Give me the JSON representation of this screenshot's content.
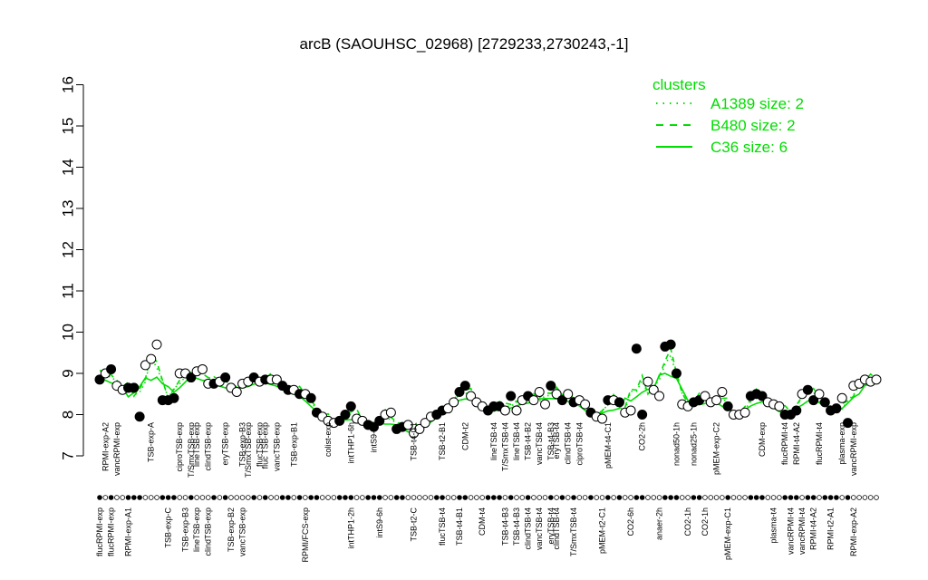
{
  "chart_data": {
    "type": "line",
    "title": "arcB (SAOUHSC_02968) [2729233,2730243,-1]",
    "ylim": [
      7,
      16
    ],
    "yticks": [
      7,
      8,
      9,
      10,
      11,
      12,
      13,
      14,
      15,
      16
    ],
    "legend": {
      "title": "clusters",
      "placement": "top-right",
      "items": [
        {
          "label": "A1389 size: 2",
          "style": "dotted"
        },
        {
          "label": "B480 size: 2",
          "style": "dashed"
        },
        {
          "label": "C36 size: 6",
          "style": "solid"
        }
      ]
    },
    "colors": {
      "lines": "#00dd00",
      "points_stroke": "#000000",
      "filled": "#000000",
      "open": "#ffffff"
    },
    "points": [
      {
        "y": 8.85,
        "f": 1
      },
      {
        "y": 9.0,
        "f": 0
      },
      {
        "y": 9.1,
        "f": 1
      },
      {
        "y": 8.7,
        "f": 0
      },
      {
        "y": 8.6,
        "f": 0
      },
      {
        "y": 8.65,
        "f": 1
      },
      {
        "y": 8.65,
        "f": 1
      },
      {
        "y": 7.95,
        "f": 1
      },
      {
        "y": 9.2,
        "f": 0
      },
      {
        "y": 9.35,
        "f": 0
      },
      {
        "y": 9.7,
        "f": 0
      },
      {
        "y": 8.35,
        "f": 1
      },
      {
        "y": 8.35,
        "f": 1
      },
      {
        "y": 8.4,
        "f": 1
      },
      {
        "y": 9.0,
        "f": 0
      },
      {
        "y": 9.0,
        "f": 0
      },
      {
        "y": 8.9,
        "f": 1
      },
      {
        "y": 9.05,
        "f": 0
      },
      {
        "y": 9.1,
        "f": 0
      },
      {
        "y": 8.75,
        "f": 0
      },
      {
        "y": 8.75,
        "f": 1
      },
      {
        "y": 8.8,
        "f": 0
      },
      {
        "y": 8.9,
        "f": 1
      },
      {
        "y": 8.65,
        "f": 0
      },
      {
        "y": 8.55,
        "f": 0
      },
      {
        "y": 8.75,
        "f": 0
      },
      {
        "y": 8.8,
        "f": 0
      },
      {
        "y": 8.9,
        "f": 1
      },
      {
        "y": 8.8,
        "f": 0
      },
      {
        "y": 8.85,
        "f": 1
      },
      {
        "y": 8.85,
        "f": 0
      },
      {
        "y": 8.85,
        "f": 0
      },
      {
        "y": 8.7,
        "f": 1
      },
      {
        "y": 8.6,
        "f": 1
      },
      {
        "y": 8.6,
        "f": 0
      },
      {
        "y": 8.5,
        "f": 1
      },
      {
        "y": 8.5,
        "f": 0
      },
      {
        "y": 8.4,
        "f": 1
      },
      {
        "y": 8.05,
        "f": 1
      },
      {
        "y": 7.95,
        "f": 0
      },
      {
        "y": 7.85,
        "f": 0
      },
      {
        "y": 7.8,
        "f": 0
      },
      {
        "y": 7.85,
        "f": 1
      },
      {
        "y": 8.0,
        "f": 1
      },
      {
        "y": 8.2,
        "f": 1
      },
      {
        "y": 7.9,
        "f": 0
      },
      {
        "y": 7.85,
        "f": 0
      },
      {
        "y": 7.75,
        "f": 1
      },
      {
        "y": 7.7,
        "f": 1
      },
      {
        "y": 7.85,
        "f": 1
      },
      {
        "y": 8.0,
        "f": 0
      },
      {
        "y": 8.05,
        "f": 0
      },
      {
        "y": 7.65,
        "f": 1
      },
      {
        "y": 7.7,
        "f": 1
      },
      {
        "y": 7.75,
        "f": 0
      },
      {
        "y": 7.55,
        "f": 0
      },
      {
        "y": 7.65,
        "f": 0
      },
      {
        "y": 7.8,
        "f": 0
      },
      {
        "y": 7.95,
        "f": 0
      },
      {
        "y": 8.0,
        "f": 1
      },
      {
        "y": 8.1,
        "f": 1
      },
      {
        "y": 8.15,
        "f": 0
      },
      {
        "y": 8.3,
        "f": 0
      },
      {
        "y": 8.55,
        "f": 1
      },
      {
        "y": 8.7,
        "f": 1
      },
      {
        "y": 8.45,
        "f": 0
      },
      {
        "y": 8.3,
        "f": 0
      },
      {
        "y": 8.2,
        "f": 0
      },
      {
        "y": 8.1,
        "f": 1
      },
      {
        "y": 8.2,
        "f": 1
      },
      {
        "y": 8.2,
        "f": 1
      },
      {
        "y": 8.1,
        "f": 0
      },
      {
        "y": 8.45,
        "f": 1
      },
      {
        "y": 8.1,
        "f": 0
      },
      {
        "y": 8.35,
        "f": 0
      },
      {
        "y": 8.45,
        "f": 1
      },
      {
        "y": 8.35,
        "f": 0
      },
      {
        "y": 8.55,
        "f": 0
      },
      {
        "y": 8.25,
        "f": 0
      },
      {
        "y": 8.7,
        "f": 1
      },
      {
        "y": 8.5,
        "f": 0
      },
      {
        "y": 8.35,
        "f": 1
      },
      {
        "y": 8.5,
        "f": 0
      },
      {
        "y": 8.3,
        "f": 1
      },
      {
        "y": 8.35,
        "f": 0
      },
      {
        "y": 8.25,
        "f": 0
      },
      {
        "y": 8.05,
        "f": 1
      },
      {
        "y": 7.95,
        "f": 0
      },
      {
        "y": 7.9,
        "f": 0
      },
      {
        "y": 8.35,
        "f": 1
      },
      {
        "y": 8.35,
        "f": 0
      },
      {
        "y": 8.3,
        "f": 1
      },
      {
        "y": 8.05,
        "f": 0
      },
      {
        "y": 8.1,
        "f": 0
      },
      {
        "y": 9.6,
        "f": 1
      },
      {
        "y": 8.0,
        "f": 1
      },
      {
        "y": 8.8,
        "f": 0
      },
      {
        "y": 8.6,
        "f": 0
      },
      {
        "y": 8.45,
        "f": 0
      },
      {
        "y": 9.65,
        "f": 1
      },
      {
        "y": 9.7,
        "f": 1
      },
      {
        "y": 9.0,
        "f": 1
      },
      {
        "y": 8.25,
        "f": 0
      },
      {
        "y": 8.2,
        "f": 0
      },
      {
        "y": 8.3,
        "f": 1
      },
      {
        "y": 8.35,
        "f": 1
      },
      {
        "y": 8.45,
        "f": 0
      },
      {
        "y": 8.3,
        "f": 0
      },
      {
        "y": 8.35,
        "f": 0
      },
      {
        "y": 8.55,
        "f": 0
      },
      {
        "y": 8.2,
        "f": 1
      },
      {
        "y": 8.0,
        "f": 0
      },
      {
        "y": 8.0,
        "f": 0
      },
      {
        "y": 8.05,
        "f": 0
      },
      {
        "y": 8.45,
        "f": 1
      },
      {
        "y": 8.5,
        "f": 1
      },
      {
        "y": 8.45,
        "f": 1
      },
      {
        "y": 8.3,
        "f": 0
      },
      {
        "y": 8.25,
        "f": 0
      },
      {
        "y": 8.2,
        "f": 0
      },
      {
        "y": 8.0,
        "f": 1
      },
      {
        "y": 8.0,
        "f": 1
      },
      {
        "y": 8.1,
        "f": 1
      },
      {
        "y": 8.5,
        "f": 0
      },
      {
        "y": 8.6,
        "f": 1
      },
      {
        "y": 8.35,
        "f": 1
      },
      {
        "y": 8.5,
        "f": 0
      },
      {
        "y": 8.3,
        "f": 1
      },
      {
        "y": 8.1,
        "f": 1
      },
      {
        "y": 8.15,
        "f": 1
      },
      {
        "y": 8.4,
        "f": 0
      },
      {
        "y": 7.8,
        "f": 1
      },
      {
        "y": 8.7,
        "f": 0
      },
      {
        "y": 8.75,
        "f": 0
      },
      {
        "y": 8.85,
        "f": 0
      },
      {
        "y": 8.8,
        "f": 0
      },
      {
        "y": 8.85,
        "f": 0
      }
    ],
    "top_labels": [
      {
        "text": "RPMI-exp-A2",
        "i": 1
      },
      {
        "text": "vancRPMI-exp",
        "i": 3
      },
      {
        "text": "TSB-exp-A",
        "i": 9
      },
      {
        "text": "ciproTSB-exp",
        "i": 14
      },
      {
        "text": "T/SmxTSB-exp",
        "i": 16
      },
      {
        "text": "lineTSB-exp",
        "i": 17
      },
      {
        "text": "clindTSB-exp",
        "i": 19
      },
      {
        "text": "eryTSB-exp",
        "i": 22
      },
      {
        "text": "T/SmxTSB-exp",
        "i": 26
      },
      {
        "text": "TSB-exp-B3",
        "i": 25
      },
      {
        "text": "flucTSB-exp",
        "i": 28
      },
      {
        "text": "fluc TSB-exp",
        "i": 29
      },
      {
        "text": "vancTSB-exp",
        "i": 31
      },
      {
        "text": "TSB-exp-B1",
        "i": 34
      },
      {
        "text": "colist-exp",
        "i": 40
      },
      {
        "text": "intTHP1-6h",
        "i": 44
      },
      {
        "text": "intS9-2h",
        "i": 48
      },
      {
        "text": "TSB-t4-C1",
        "i": 55
      },
      {
        "text": "TSB-t2-B1",
        "i": 60
      },
      {
        "text": "CDM-t2",
        "i": 64
      },
      {
        "text": "lineTSB-t4",
        "i": 69
      },
      {
        "text": "T/SmxTSB-t4",
        "i": 71
      },
      {
        "text": "lineTSB-t4",
        "i": 73
      },
      {
        "text": "TSB-t4-B2",
        "i": 75
      },
      {
        "text": "vancTSB-t4",
        "i": 77
      },
      {
        "text": "TSB-t4-B3",
        "i": 79
      },
      {
        "text": "eryTSB-t4",
        "i": 80
      },
      {
        "text": "clindTSB-t4",
        "i": 82
      },
      {
        "text": "ciproTSB-t4",
        "i": 84
      },
      {
        "text": "pMEM-t4-C1",
        "i": 89
      },
      {
        "text": "CO2-2h",
        "i": 95
      },
      {
        "text": "nonad50-1h",
        "i": 101
      },
      {
        "text": "nonad25-1h",
        "i": 104
      },
      {
        "text": "pMEM-exp-C2",
        "i": 108
      },
      {
        "text": "CDM-exp",
        "i": 116
      },
      {
        "text": "flucRPMI-t4",
        "i": 120
      },
      {
        "text": "RPMI-t4-A2",
        "i": 122
      },
      {
        "text": "flucRPMI-t4",
        "i": 126
      },
      {
        "text": "plasma-exp",
        "i": 130
      },
      {
        "text": "vancRPMI-exp",
        "i": 132
      }
    ],
    "bottom_labels": [
      {
        "text": "flucRPMI-exp",
        "i": 0
      },
      {
        "text": "flucRPMI-exp",
        "i": 2
      },
      {
        "text": "RPMI-exp-A1",
        "i": 5
      },
      {
        "text": "TSB-exp-C",
        "i": 12
      },
      {
        "text": "TSB-exp-B3",
        "i": 15
      },
      {
        "text": "lineTSB-exp",
        "i": 17
      },
      {
        "text": "clindTSB-exp",
        "i": 19
      },
      {
        "text": "TSB-exp-B2",
        "i": 23
      },
      {
        "text": "vancTSB-exp",
        "i": 25
      },
      {
        "text": "RPMI/FCS-exp",
        "i": 36
      },
      {
        "text": "intTHP1-2h",
        "i": 44
      },
      {
        "text": "intS9-6h",
        "i": 49
      },
      {
        "text": "TSB-t2-C",
        "i": 55
      },
      {
        "text": "flucTSB-t4",
        "i": 60
      },
      {
        "text": "TSB-t4-B1",
        "i": 63
      },
      {
        "text": "CDM-t4",
        "i": 67
      },
      {
        "text": "TSB-t4-B3",
        "i": 71
      },
      {
        "text": "TSB-t4-B3",
        "i": 73
      },
      {
        "text": "clindTSB-t4",
        "i": 75
      },
      {
        "text": "vancTSB-t4",
        "i": 77
      },
      {
        "text": "eryTSB-t4",
        "i": 79
      },
      {
        "text": "clindTSB-t4",
        "i": 80
      },
      {
        "text": "T/SmxTSB-t4",
        "i": 83
      },
      {
        "text": "pMEM-t2-C1",
        "i": 88
      },
      {
        "text": "CO2-6h",
        "i": 93
      },
      {
        "text": "anaer-2h",
        "i": 98
      },
      {
        "text": "CO2-1h",
        "i": 103
      },
      {
        "text": "CO2-1h",
        "i": 106
      },
      {
        "text": "pMEM-exp-C1",
        "i": 110
      },
      {
        "text": "plasma-t4",
        "i": 118
      },
      {
        "text": "vancRPMI-t4",
        "i": 121
      },
      {
        "text": "vancRPMI-t4",
        "i": 123
      },
      {
        "text": "RPMI-t4-A2",
        "i": 125
      },
      {
        "text": "RPMI-t2-A1",
        "i": 128
      },
      {
        "text": "RPMI-exp-A2",
        "i": 132
      }
    ]
  }
}
